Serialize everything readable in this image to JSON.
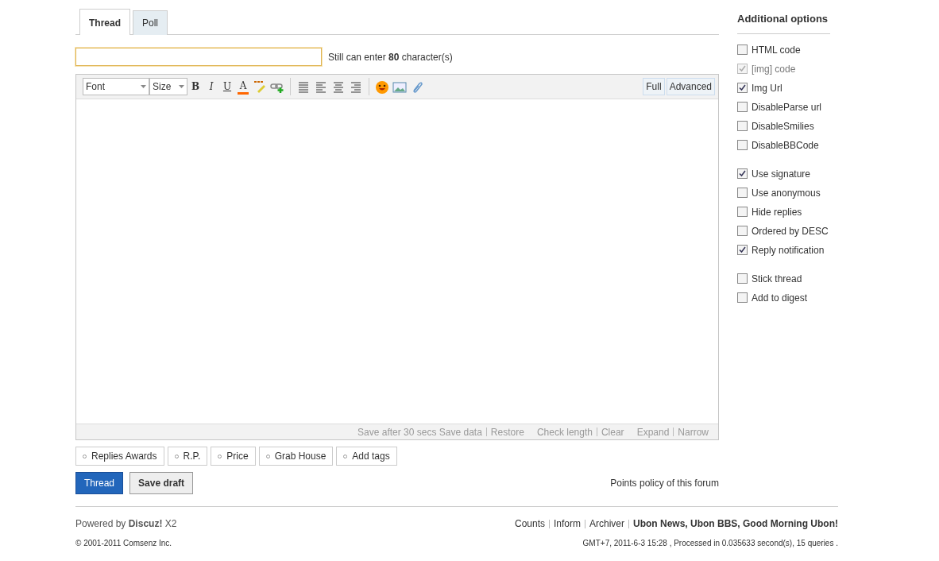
{
  "tabs": [
    {
      "label": "Thread",
      "selected": true
    },
    {
      "label": "Poll",
      "selected": false
    }
  ],
  "subject": {
    "hint": "Still can enter **80** character(s)"
  },
  "toolbar": {
    "font": "Font",
    "size": "Size",
    "buttons": [
      {
        "kind": "bold",
        "label": "B"
      },
      {
        "kind": "italic",
        "label": "I"
      },
      {
        "kind": "underline",
        "label": "U"
      },
      {
        "kind": "color",
        "label": "A"
      },
      {
        "kind": "highlight"
      },
      {
        "kind": "link"
      },
      {
        "kind": "sep"
      },
      {
        "kind": "align-justify"
      },
      {
        "kind": "align-left"
      },
      {
        "kind": "align-center"
      },
      {
        "kind": "align-right"
      },
      {
        "kind": "sep"
      },
      {
        "kind": "smiley"
      },
      {
        "kind": "image"
      },
      {
        "kind": "attach"
      }
    ],
    "modes": [
      "Full",
      "Advanced"
    ]
  },
  "status_bar": [
    {
      "text": "Save after 30 secs",
      "links": [
        "Save data",
        "Restore"
      ]
    },
    {
      "links": [
        "Check length",
        "Clear"
      ]
    },
    {
      "links": [
        "Expand",
        "Narrow"
      ]
    }
  ],
  "extras": [
    "Replies Awards",
    "R.P.",
    "Price",
    "Grab House",
    "Add tags"
  ],
  "buttons": {
    "submit": "Thread",
    "draft": "Save draft"
  },
  "policy_link": "Points policy of this forum",
  "options": {
    "title": "Additional options",
    "groups": [
      [
        {
          "label": "HTML code",
          "checked": false,
          "disabled": false
        },
        {
          "label": "[img] code",
          "checked": true,
          "disabled": true
        },
        {
          "label": "Img Url",
          "checked": true,
          "disabled": false
        },
        {
          "label": "DisableParse url",
          "checked": false,
          "disabled": false
        },
        {
          "label": "DisableSmilies",
          "checked": false,
          "disabled": false
        },
        {
          "label": "DisableBBCode",
          "checked": false,
          "disabled": false
        }
      ],
      [
        {
          "label": "Use signature",
          "checked": true,
          "disabled": false
        },
        {
          "label": "Use anonymous",
          "checked": false,
          "disabled": false
        },
        {
          "label": "Hide replies",
          "checked": false,
          "disabled": false
        },
        {
          "label": "Ordered by DESC",
          "checked": false,
          "disabled": false
        },
        {
          "label": "Reply notification",
          "checked": true,
          "disabled": false
        }
      ],
      [
        {
          "label": "Stick thread",
          "checked": false,
          "disabled": false
        },
        {
          "label": "Add to digest",
          "checked": false,
          "disabled": false
        }
      ]
    ]
  },
  "footer": {
    "powered": "Powered by **Discuz!** X2",
    "copyright": "© 2001-2011 Comsenz Inc.",
    "links": [
      "Counts",
      "Inform",
      "Archiver"
    ],
    "site": "Ubon News, Ubon BBS, Good Morning Ubon!",
    "info": "GMT+7, 2011-6-3 15:28 , Processed in 0.035633 second(s), 15 queries ."
  }
}
